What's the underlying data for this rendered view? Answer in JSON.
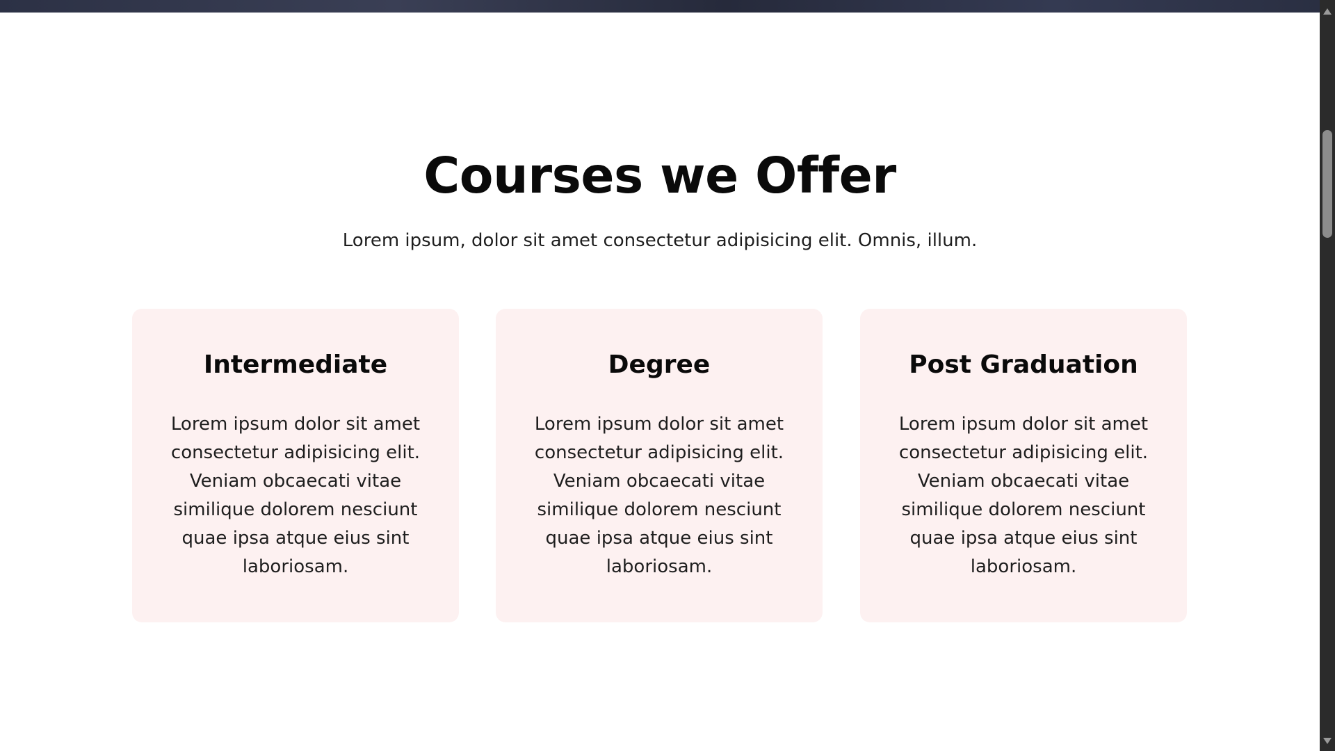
{
  "section": {
    "title": "Courses we Offer",
    "subtitle": "Lorem ipsum, dolor sit amet consectetur adipisicing elit. Omnis, illum."
  },
  "cards": [
    {
      "title": "Intermediate",
      "text": "Lorem ipsum dolor sit amet consectetur adipisicing elit. Veniam obcaecati vitae similique dolorem nesciunt quae ipsa atque eius sint laboriosam."
    },
    {
      "title": "Degree",
      "text": "Lorem ipsum dolor sit amet consectetur adipisicing elit. Veniam obcaecati vitae similique dolorem nesciunt quae ipsa atque eius sint laboriosam."
    },
    {
      "title": "Post Graduation",
      "text": "Lorem ipsum dolor sit amet consectetur adipisicing elit. Veniam obcaecati vitae similique dolorem nesciunt quae ipsa atque eius sint laboriosam."
    }
  ],
  "colors": {
    "card_background": "#fdf1f1",
    "heading": "#0a0a0a",
    "body_text": "#1e1e1e",
    "hero_strip": "#2c3145",
    "scrollbar_track": "#2b2b2b",
    "scrollbar_thumb": "#8c8c8c"
  },
  "icons": {
    "scroll_up": "chevron-up-icon",
    "scroll_down": "chevron-down-icon"
  }
}
